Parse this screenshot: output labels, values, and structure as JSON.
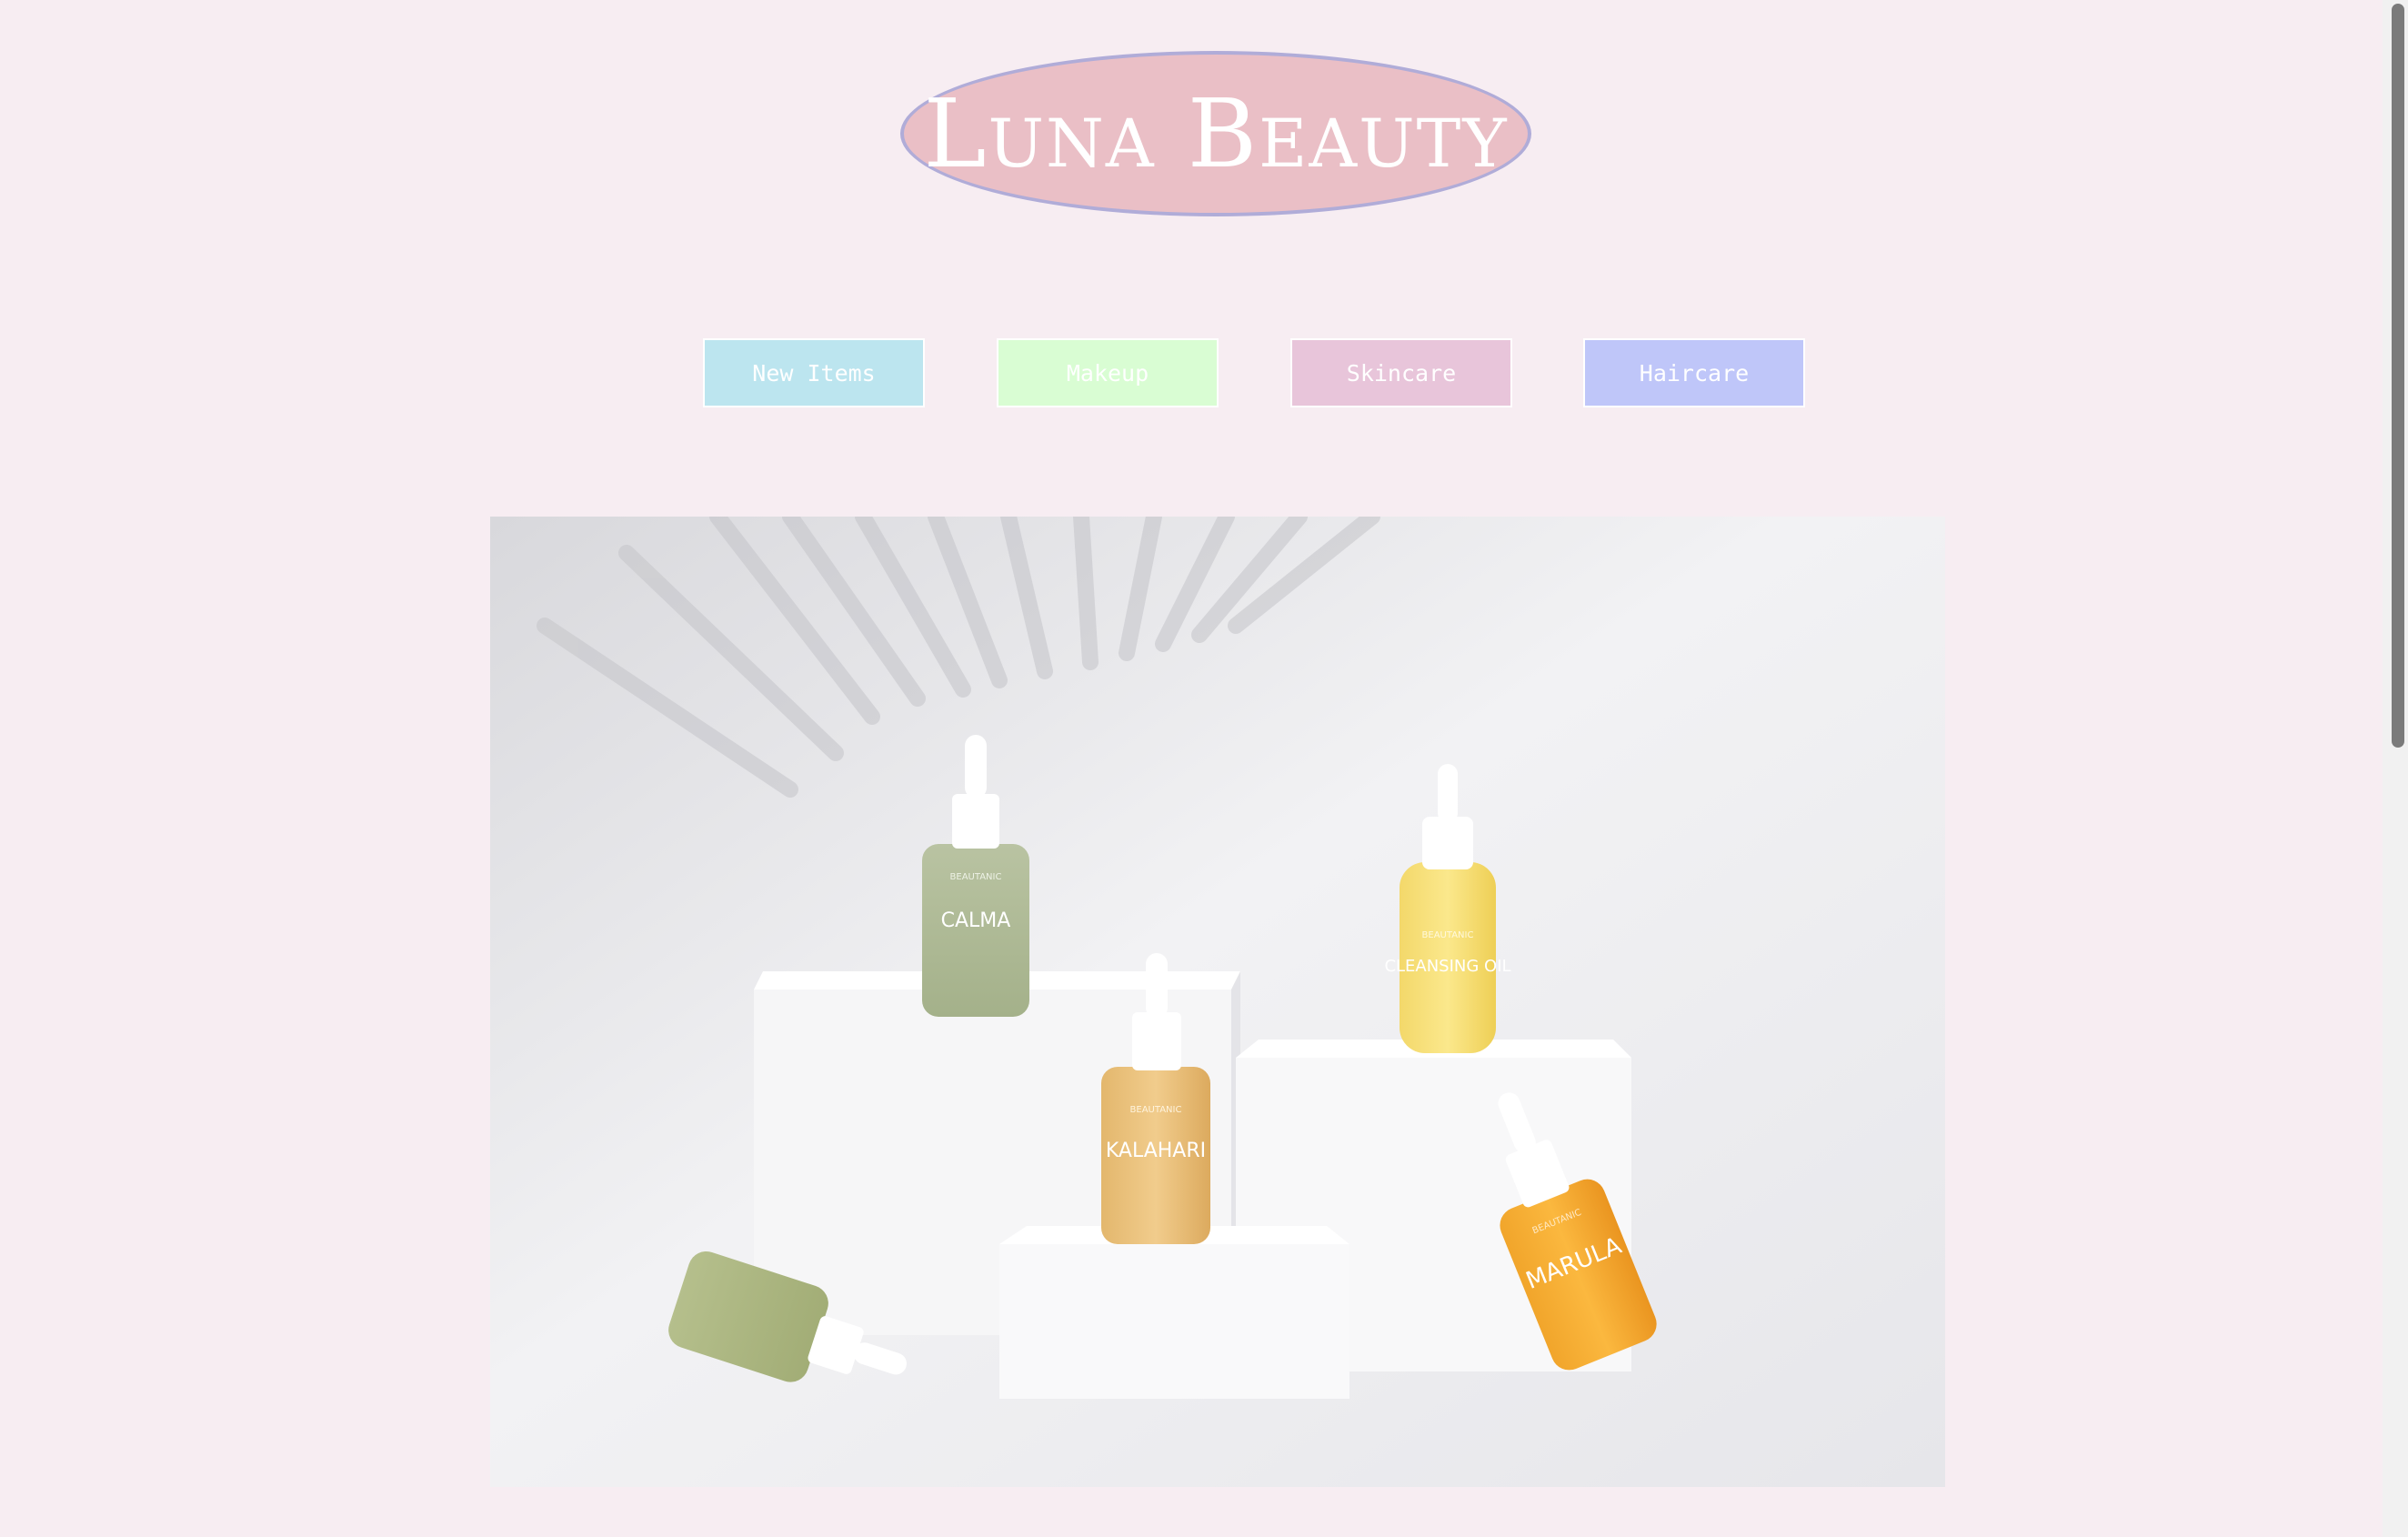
{
  "brand": {
    "name": "Luna Beauty"
  },
  "nav": {
    "items": [
      {
        "label": "New Items",
        "color": "#bce5ef"
      },
      {
        "label": "Makeup",
        "color": "#d9fdd3"
      },
      {
        "label": "Skincare",
        "color": "#e8c5da"
      },
      {
        "label": "Haircare",
        "color": "#bfc6f9"
      }
    ]
  },
  "hero": {
    "products": [
      {
        "brand": "BEAUTANIC",
        "name": "CALMA"
      },
      {
        "brand": "BEAUTANIC",
        "name": "CLEANSING OIL"
      },
      {
        "brand": "BEAUTANIC",
        "name": "KALAHARI"
      },
      {
        "brand": "BEAUTANIC",
        "name": "MARULA"
      }
    ]
  }
}
